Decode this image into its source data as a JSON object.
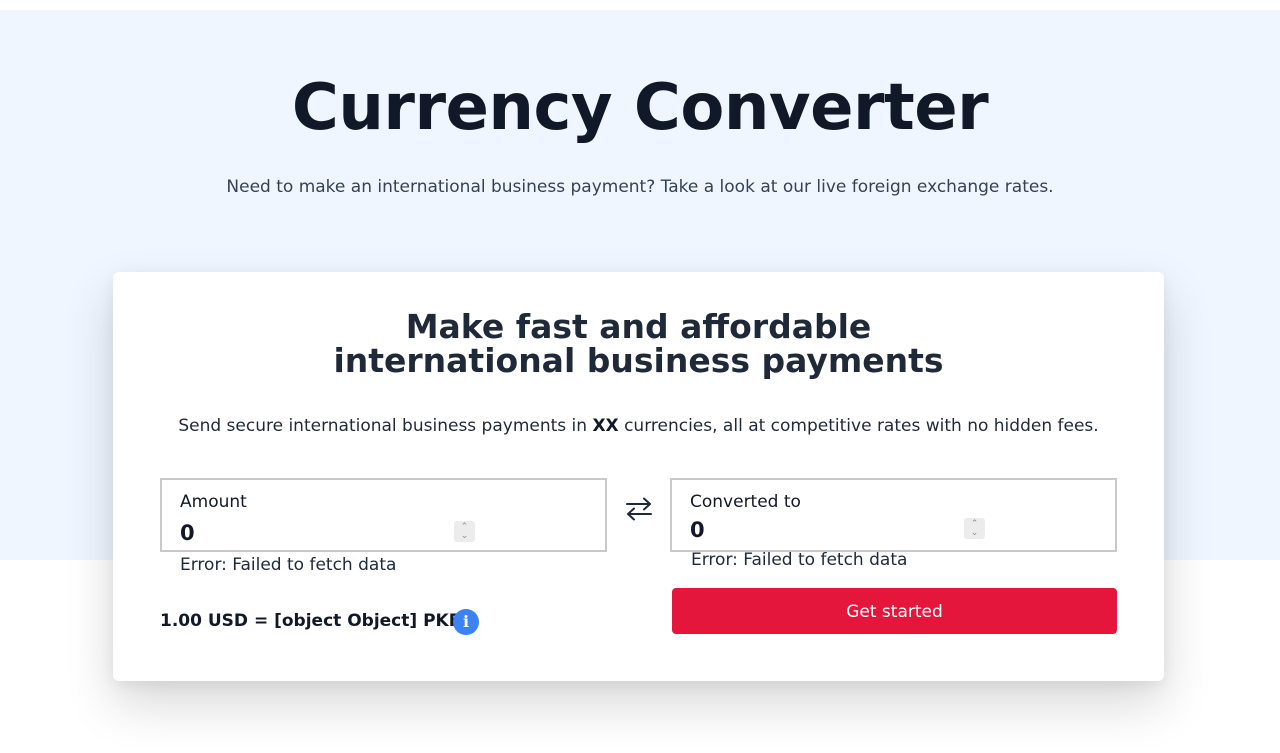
{
  "hero": {
    "title": "Currency Converter",
    "subtitle": "Need to make an international business payment? Take a look at our live foreign exchange rates."
  },
  "card": {
    "heading_line1": "Make fast and affordable",
    "heading_line2": "international business payments",
    "desc_before": "Send secure international business payments in ",
    "desc_bold": "XX",
    "desc_after": " currencies, all at competitive rates with no hidden fees."
  },
  "amount_field": {
    "label": "Amount",
    "value": "0",
    "error": "Error: Failed to fetch data"
  },
  "converted_field": {
    "label": "Converted to",
    "value": "0",
    "error": "Error: Failed to fetch data"
  },
  "rate": {
    "text": "1.00 USD = [object Object] PKR"
  },
  "icons": {
    "swap": "swap-arrows-icon",
    "info": "info-icon",
    "info_glyph": "i",
    "spinner_up": "⌃",
    "spinner_down": "⌄"
  },
  "cta": {
    "label": "Get started"
  },
  "colors": {
    "hero_bg": "#eff6ff",
    "cta_bg": "#e5163b",
    "info_bg": "#3b82f6",
    "text_dark": "#111827"
  }
}
